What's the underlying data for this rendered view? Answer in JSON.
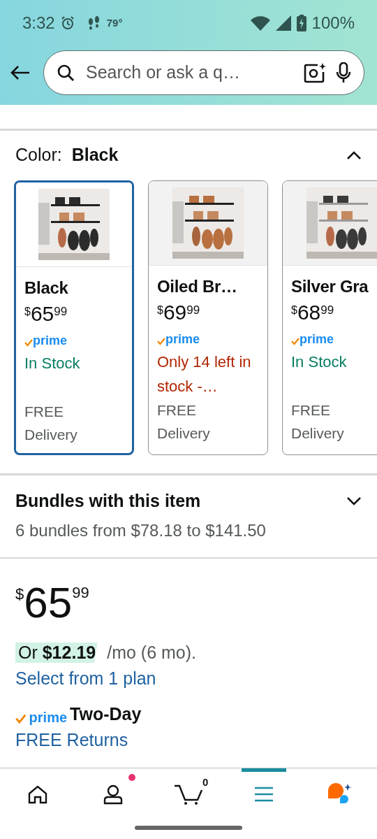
{
  "status_bar": {
    "time": "3:32",
    "temperature": "79°",
    "battery": "100%"
  },
  "search": {
    "placeholder": "Search or ask a q…"
  },
  "color_selector": {
    "label": "Color:",
    "value": "Black",
    "expanded": true,
    "options": [
      {
        "name": "Black",
        "price": {
          "symbol": "$",
          "whole": "65",
          "fraction": "99"
        },
        "prime": "prime",
        "stock": {
          "kind": "in",
          "text": "In Stock"
        },
        "shipping": [
          "FREE",
          "Delivery"
        ],
        "selected": true
      },
      {
        "name": "Oiled Br…",
        "price": {
          "symbol": "$",
          "whole": "69",
          "fraction": "99"
        },
        "prime": "prime",
        "stock": {
          "kind": "low",
          "text": "Only 14 left in stock -…"
        },
        "shipping": [
          "FREE",
          "Delivery"
        ],
        "selected": false
      },
      {
        "name": "Silver Gra",
        "price": {
          "symbol": "$",
          "whole": "68",
          "fraction": "99"
        },
        "prime": "prime",
        "stock": {
          "kind": "in",
          "text": "In Stock"
        },
        "shipping": [
          "FREE",
          "Delivery"
        ],
        "selected": false
      }
    ]
  },
  "bundles": {
    "title": "Bundles with this item",
    "summary": "6 bundles from $78.18 to $141.50",
    "expanded": false
  },
  "price": {
    "symbol": "$",
    "whole": "65",
    "fraction": "99"
  },
  "installment": {
    "amount": "Or **$12.19**",
    "term": "/mo (6 mo)."
  },
  "plan_link": "Select from 1 plan",
  "delivery": {
    "prime": "prime",
    "label": "Two-Day"
  },
  "returns_link": "FREE Returns",
  "bottom_nav": [
    {
      "kind": "home",
      "selected": false
    },
    {
      "kind": "account",
      "selected": false,
      "notification": true
    },
    {
      "kind": "cart",
      "selected": false,
      "count": "0"
    },
    {
      "kind": "menu",
      "selected": true
    },
    {
      "kind": "assistant",
      "selected": false
    }
  ]
}
